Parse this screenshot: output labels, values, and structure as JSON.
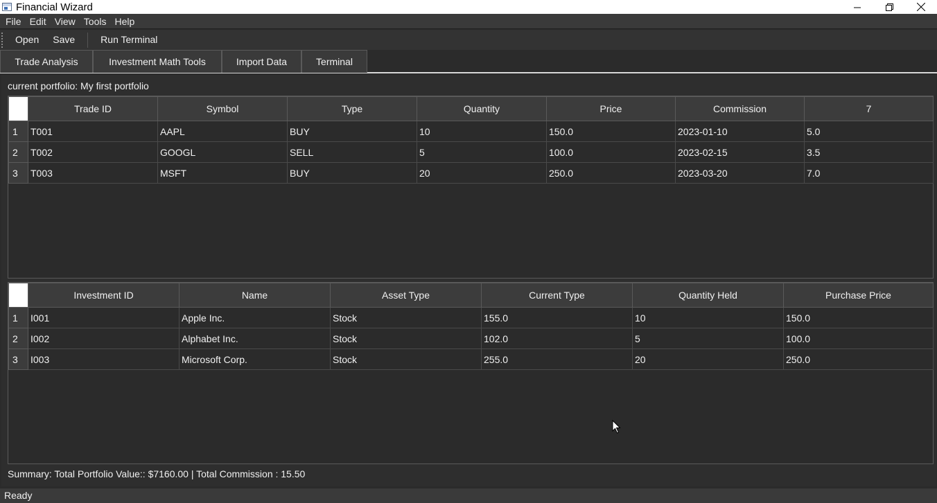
{
  "window": {
    "title": "Financial Wizard",
    "controls": {
      "minimize": "—",
      "restore": "❐",
      "close": "✕"
    }
  },
  "menubar": {
    "items": [
      "File",
      "Edit",
      "View",
      "Tools",
      "Help"
    ]
  },
  "toolbar": {
    "open_label": "Open",
    "save_label": "Save",
    "run_terminal_label": "Run Terminal"
  },
  "tabs": [
    {
      "label": "Trade Analysis"
    },
    {
      "label": "Investment  Math Tools"
    },
    {
      "label": "Import Data"
    },
    {
      "label": "Terminal"
    }
  ],
  "main": {
    "portfolio_label": "current portfolio: My first portfolio",
    "trades_table": {
      "headers": [
        "Trade ID",
        "Symbol",
        "Type",
        "Quantity",
        "Price",
        "Commission",
        "7"
      ],
      "rows": [
        {
          "num": "1",
          "cells": [
            "T001",
            "AAPL",
            "BUY",
            "10",
            "150.0",
            "2023-01-10",
            "5.0"
          ]
        },
        {
          "num": "2",
          "cells": [
            "T002",
            "GOOGL",
            "SELL",
            "5",
            "100.0",
            "2023-02-15",
            "3.5"
          ]
        },
        {
          "num": "3",
          "cells": [
            "T003",
            "MSFT",
            "BUY",
            "20",
            "250.0",
            "2023-03-20",
            "7.0"
          ]
        }
      ]
    },
    "investments_table": {
      "headers": [
        "Investment ID",
        "Name",
        "Asset Type",
        "Current Type",
        "Quantity Held",
        "Purchase Price"
      ],
      "rows": [
        {
          "num": "1",
          "cells": [
            "I001",
            "Apple Inc.",
            "Stock",
            "155.0",
            "10",
            "150.0"
          ]
        },
        {
          "num": "2",
          "cells": [
            "I002",
            "Alphabet Inc.",
            "Stock",
            "102.0",
            "5",
            "100.0"
          ]
        },
        {
          "num": "3",
          "cells": [
            "I003",
            "Microsoft Corp.",
            "Stock",
            "255.0",
            "20",
            "250.0"
          ]
        }
      ]
    },
    "summary": "Summary: Total Portfolio Value:: $7160.00 | Total Commission : 15.50"
  },
  "statusbar": {
    "text": "Ready"
  }
}
